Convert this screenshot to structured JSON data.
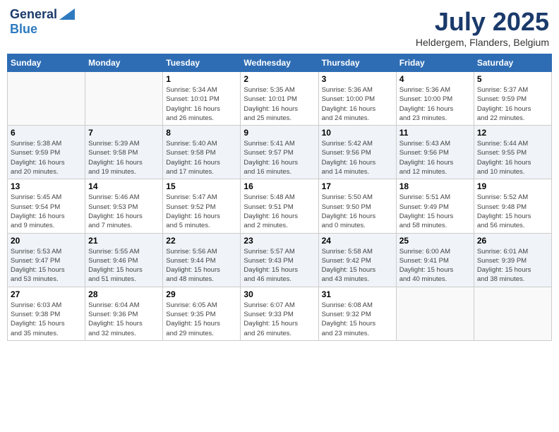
{
  "header": {
    "logo_general": "General",
    "logo_blue": "Blue",
    "month": "July 2025",
    "location": "Heldergem, Flanders, Belgium"
  },
  "weekdays": [
    "Sunday",
    "Monday",
    "Tuesday",
    "Wednesday",
    "Thursday",
    "Friday",
    "Saturday"
  ],
  "weeks": [
    [
      {
        "day": "",
        "info": ""
      },
      {
        "day": "",
        "info": ""
      },
      {
        "day": "1",
        "info": "Sunrise: 5:34 AM\nSunset: 10:01 PM\nDaylight: 16 hours\nand 26 minutes."
      },
      {
        "day": "2",
        "info": "Sunrise: 5:35 AM\nSunset: 10:01 PM\nDaylight: 16 hours\nand 25 minutes."
      },
      {
        "day": "3",
        "info": "Sunrise: 5:36 AM\nSunset: 10:00 PM\nDaylight: 16 hours\nand 24 minutes."
      },
      {
        "day": "4",
        "info": "Sunrise: 5:36 AM\nSunset: 10:00 PM\nDaylight: 16 hours\nand 23 minutes."
      },
      {
        "day": "5",
        "info": "Sunrise: 5:37 AM\nSunset: 9:59 PM\nDaylight: 16 hours\nand 22 minutes."
      }
    ],
    [
      {
        "day": "6",
        "info": "Sunrise: 5:38 AM\nSunset: 9:59 PM\nDaylight: 16 hours\nand 20 minutes."
      },
      {
        "day": "7",
        "info": "Sunrise: 5:39 AM\nSunset: 9:58 PM\nDaylight: 16 hours\nand 19 minutes."
      },
      {
        "day": "8",
        "info": "Sunrise: 5:40 AM\nSunset: 9:58 PM\nDaylight: 16 hours\nand 17 minutes."
      },
      {
        "day": "9",
        "info": "Sunrise: 5:41 AM\nSunset: 9:57 PM\nDaylight: 16 hours\nand 16 minutes."
      },
      {
        "day": "10",
        "info": "Sunrise: 5:42 AM\nSunset: 9:56 PM\nDaylight: 16 hours\nand 14 minutes."
      },
      {
        "day": "11",
        "info": "Sunrise: 5:43 AM\nSunset: 9:56 PM\nDaylight: 16 hours\nand 12 minutes."
      },
      {
        "day": "12",
        "info": "Sunrise: 5:44 AM\nSunset: 9:55 PM\nDaylight: 16 hours\nand 10 minutes."
      }
    ],
    [
      {
        "day": "13",
        "info": "Sunrise: 5:45 AM\nSunset: 9:54 PM\nDaylight: 16 hours\nand 9 minutes."
      },
      {
        "day": "14",
        "info": "Sunrise: 5:46 AM\nSunset: 9:53 PM\nDaylight: 16 hours\nand 7 minutes."
      },
      {
        "day": "15",
        "info": "Sunrise: 5:47 AM\nSunset: 9:52 PM\nDaylight: 16 hours\nand 5 minutes."
      },
      {
        "day": "16",
        "info": "Sunrise: 5:48 AM\nSunset: 9:51 PM\nDaylight: 16 hours\nand 2 minutes."
      },
      {
        "day": "17",
        "info": "Sunrise: 5:50 AM\nSunset: 9:50 PM\nDaylight: 16 hours\nand 0 minutes."
      },
      {
        "day": "18",
        "info": "Sunrise: 5:51 AM\nSunset: 9:49 PM\nDaylight: 15 hours\nand 58 minutes."
      },
      {
        "day": "19",
        "info": "Sunrise: 5:52 AM\nSunset: 9:48 PM\nDaylight: 15 hours\nand 56 minutes."
      }
    ],
    [
      {
        "day": "20",
        "info": "Sunrise: 5:53 AM\nSunset: 9:47 PM\nDaylight: 15 hours\nand 53 minutes."
      },
      {
        "day": "21",
        "info": "Sunrise: 5:55 AM\nSunset: 9:46 PM\nDaylight: 15 hours\nand 51 minutes."
      },
      {
        "day": "22",
        "info": "Sunrise: 5:56 AM\nSunset: 9:44 PM\nDaylight: 15 hours\nand 48 minutes."
      },
      {
        "day": "23",
        "info": "Sunrise: 5:57 AM\nSunset: 9:43 PM\nDaylight: 15 hours\nand 46 minutes."
      },
      {
        "day": "24",
        "info": "Sunrise: 5:58 AM\nSunset: 9:42 PM\nDaylight: 15 hours\nand 43 minutes."
      },
      {
        "day": "25",
        "info": "Sunrise: 6:00 AM\nSunset: 9:41 PM\nDaylight: 15 hours\nand 40 minutes."
      },
      {
        "day": "26",
        "info": "Sunrise: 6:01 AM\nSunset: 9:39 PM\nDaylight: 15 hours\nand 38 minutes."
      }
    ],
    [
      {
        "day": "27",
        "info": "Sunrise: 6:03 AM\nSunset: 9:38 PM\nDaylight: 15 hours\nand 35 minutes."
      },
      {
        "day": "28",
        "info": "Sunrise: 6:04 AM\nSunset: 9:36 PM\nDaylight: 15 hours\nand 32 minutes."
      },
      {
        "day": "29",
        "info": "Sunrise: 6:05 AM\nSunset: 9:35 PM\nDaylight: 15 hours\nand 29 minutes."
      },
      {
        "day": "30",
        "info": "Sunrise: 6:07 AM\nSunset: 9:33 PM\nDaylight: 15 hours\nand 26 minutes."
      },
      {
        "day": "31",
        "info": "Sunrise: 6:08 AM\nSunset: 9:32 PM\nDaylight: 15 hours\nand 23 minutes."
      },
      {
        "day": "",
        "info": ""
      },
      {
        "day": "",
        "info": ""
      }
    ]
  ]
}
